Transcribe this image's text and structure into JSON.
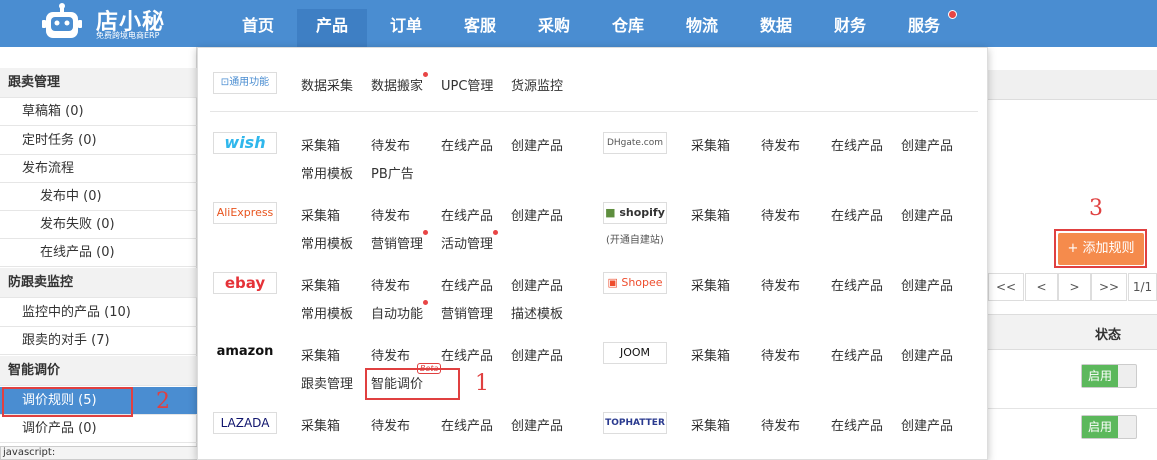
{
  "logo": {
    "name": "店小秘",
    "tagline": "免费跨境电商ERP"
  },
  "nav": [
    {
      "label": "首页"
    },
    {
      "label": "产品"
    },
    {
      "label": "订单"
    },
    {
      "label": "客服"
    },
    {
      "label": "采购"
    },
    {
      "label": "仓库"
    },
    {
      "label": "物流"
    },
    {
      "label": "数据"
    },
    {
      "label": "财务"
    },
    {
      "label": "服务"
    }
  ],
  "sidebar": {
    "sec1": "跟卖管理",
    "draft": "草稿箱 (0)",
    "timed": "定时任务 (0)",
    "flow": "发布流程",
    "publishing": "发布中 (0)",
    "failed": "发布失败 (0)",
    "online": "在线产品 (0)",
    "sec2": "防跟卖监控",
    "monitoring": "监控中的产品 (10)",
    "rivals": "跟卖的对手 (7)",
    "sec3": "智能调价",
    "rules": "调价规则 (5)",
    "products": "调价产品 (0)"
  },
  "status_url": "javascript:",
  "general": {
    "badge": "通用功能",
    "collect": "数据采集",
    "move": "数据搬家",
    "upc": "UPC管理",
    "source": "货源监控"
  },
  "links": {
    "collect_box": "采集箱",
    "pending": "待发布",
    "online_products": "在线产品",
    "create": "创建产品",
    "template": "常用模板",
    "pb_ad": "PB广告",
    "marketing": "营销管理",
    "activity": "活动管理",
    "auto": "自动功能",
    "desc_template": "描述模板",
    "follow_sell": "跟卖管理",
    "smart_price": "智能调价",
    "beta": "Beta",
    "shopify_note": "(开通自建站)"
  },
  "platforms": {
    "wish": "wish",
    "dhgate": "DHgate.com",
    "aliexpress": "AliExpress",
    "shopify": "shopify",
    "ebay": "ebay",
    "shopee": "Shopee",
    "amazon": "amazon",
    "joom": "JOOM",
    "lazada": "LAZADA",
    "tophatter": "TOPHATTER"
  },
  "right": {
    "add_rule": "+ 添加规则",
    "pager": [
      "<<",
      "<",
      ">",
      ">>",
      "1/1"
    ],
    "status_header": "状态",
    "enable": "启用"
  },
  "annotations": {
    "n1": "1",
    "n2": "2",
    "n3": "3"
  },
  "colors": {
    "nav_bg": "#4a8dd1",
    "accent_orange": "#f58b4c",
    "annotation_red": "#e04040",
    "enable_green": "#5cb85c"
  }
}
